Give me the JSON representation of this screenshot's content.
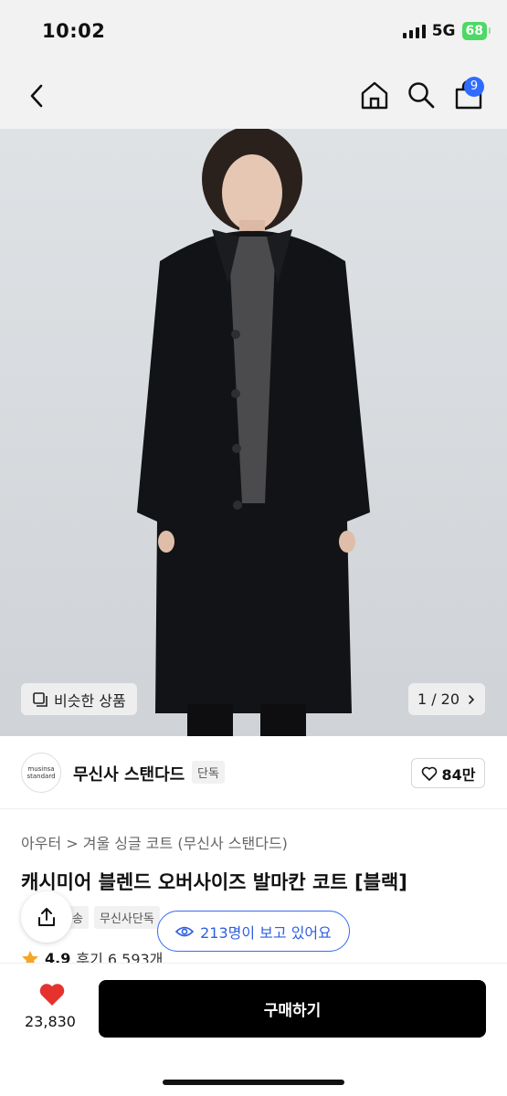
{
  "status_bar": {
    "time": "10:02",
    "network": "5G",
    "battery": "68"
  },
  "nav": {
    "cart_count": "9",
    "icons": [
      "back-icon",
      "home-icon",
      "search-icon",
      "cart-icon"
    ]
  },
  "gallery": {
    "similar_label": "비슷한 상품",
    "counter": "1 / 20"
  },
  "brand": {
    "logo_line1": "musinsa",
    "logo_line2": "standard",
    "name": "무신사 스탠다드",
    "tag": "단독",
    "likes": "84만"
  },
  "product": {
    "category": "아우터 > 겨울 싱글 코트 (무신사 스탠다드)",
    "title": "캐시미어 블렌드 오버사이즈 발마칸 코트 [블랙]",
    "tags": [
      "송",
      "무신사단독"
    ],
    "viewers": "213명이 보고 있어요",
    "rating": "4.9",
    "reviews": "후기 6,593개"
  },
  "bottom": {
    "fav_count": "23,830",
    "buy_label": "구매하기"
  },
  "colors": {
    "accent_blue": "#2f5fe0",
    "heart_red": "#e5322d",
    "badge_blue": "#2f6bff",
    "battery_green": "#4cd964"
  }
}
